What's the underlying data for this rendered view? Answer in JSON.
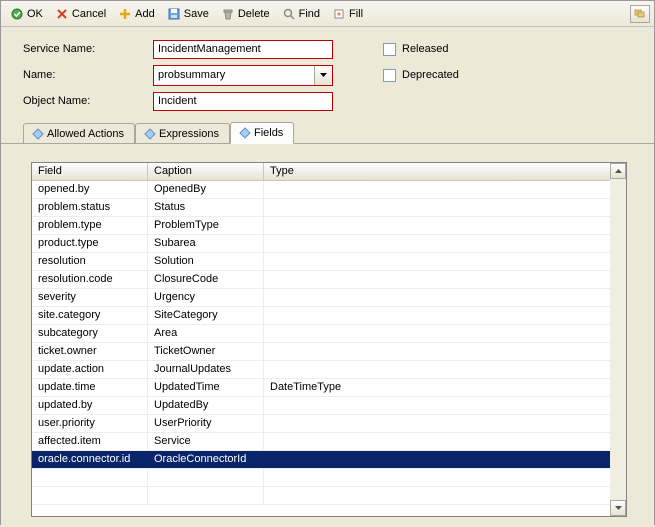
{
  "toolbar": {
    "ok": "OK",
    "cancel": "Cancel",
    "add": "Add",
    "save": "Save",
    "delete": "Delete",
    "find": "Find",
    "fill": "Fill"
  },
  "form": {
    "service_name_label": "Service Name:",
    "service_name_value": "IncidentManagement",
    "name_label": "Name:",
    "name_value": "probsummary",
    "object_name_label": "Object Name:",
    "object_name_value": "Incident",
    "released_label": "Released",
    "deprecated_label": "Deprecated"
  },
  "tabs": {
    "allowed_actions": "Allowed Actions",
    "expressions": "Expressions",
    "fields": "Fields"
  },
  "grid": {
    "headers": {
      "field": "Field",
      "caption": "Caption",
      "type": "Type"
    },
    "rows": [
      {
        "field": "opened.by",
        "caption": "OpenedBy",
        "type": ""
      },
      {
        "field": "problem.status",
        "caption": "Status",
        "type": ""
      },
      {
        "field": "problem.type",
        "caption": "ProblemType",
        "type": ""
      },
      {
        "field": "product.type",
        "caption": "Subarea",
        "type": ""
      },
      {
        "field": "resolution",
        "caption": "Solution",
        "type": ""
      },
      {
        "field": "resolution.code",
        "caption": "ClosureCode",
        "type": ""
      },
      {
        "field": "severity",
        "caption": "Urgency",
        "type": ""
      },
      {
        "field": "site.category",
        "caption": "SiteCategory",
        "type": ""
      },
      {
        "field": "subcategory",
        "caption": "Area",
        "type": ""
      },
      {
        "field": "ticket.owner",
        "caption": "TicketOwner",
        "type": ""
      },
      {
        "field": "update.action",
        "caption": "JournalUpdates",
        "type": ""
      },
      {
        "field": "update.time",
        "caption": "UpdatedTime",
        "type": "DateTimeType"
      },
      {
        "field": "updated.by",
        "caption": "UpdatedBy",
        "type": ""
      },
      {
        "field": "user.priority",
        "caption": "UserPriority",
        "type": ""
      },
      {
        "field": "affected.item",
        "caption": "Service",
        "type": ""
      },
      {
        "field": "oracle.connector.id",
        "caption": "OracleConnectorId",
        "type": "",
        "selected": true
      }
    ]
  }
}
